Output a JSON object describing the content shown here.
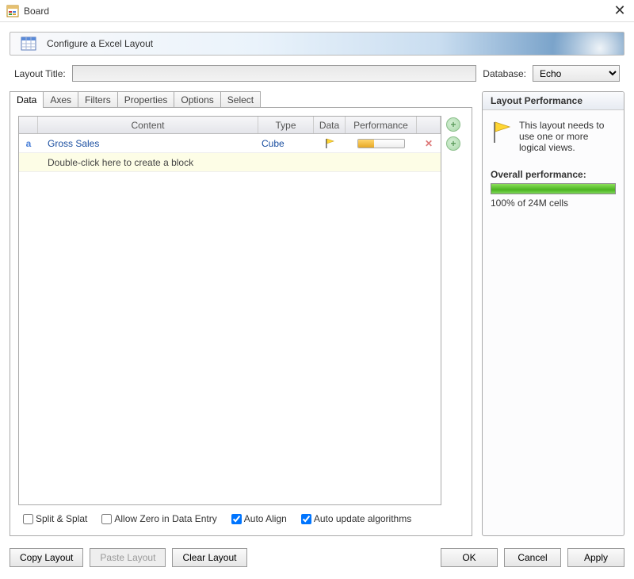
{
  "window": {
    "title": "Board"
  },
  "header": {
    "title": "Configure a Excel Layout"
  },
  "layout": {
    "title_label": "Layout Title:",
    "title_value": "",
    "database_label": "Database:",
    "database_value": "Echo"
  },
  "tabs": {
    "data": "Data",
    "axes": "Axes",
    "filters": "Filters",
    "properties": "Properties",
    "options": "Options",
    "select": "Select"
  },
  "grid": {
    "headers": {
      "content": "Content",
      "type": "Type",
      "data": "Data",
      "performance": "Performance"
    },
    "rows": [
      {
        "handle": "a",
        "content": "Gross Sales",
        "type": "Cube",
        "has_flag": true,
        "has_perf": true,
        "deletable": true
      }
    ],
    "hint_row": "Double-click here to create a block"
  },
  "checks": {
    "split": {
      "label": "Split & Splat",
      "checked": false
    },
    "allow_zero": {
      "label": "Allow Zero in Data Entry",
      "checked": false
    },
    "auto_align": {
      "label": "Auto Align",
      "checked": true
    },
    "auto_update": {
      "label": "Auto update algorithms",
      "checked": true
    }
  },
  "performance": {
    "header": "Layout Performance",
    "message": "This layout needs to use one or more logical views.",
    "overall_label": "Overall performance:",
    "overall_text": "100% of 24M cells"
  },
  "buttons": {
    "copy": "Copy Layout",
    "paste": "Paste Layout",
    "clear": "Clear Layout",
    "ok": "OK",
    "cancel": "Cancel",
    "apply": "Apply"
  }
}
